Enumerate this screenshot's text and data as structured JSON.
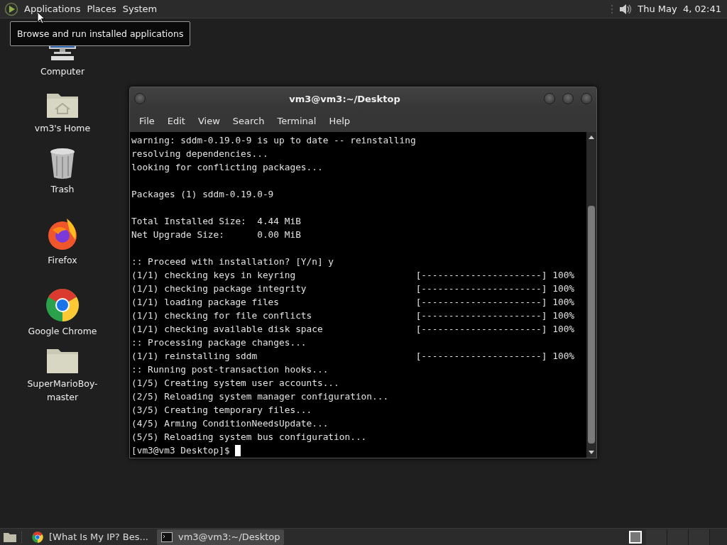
{
  "top_panel": {
    "menus": [
      "Applications",
      "Places",
      "System"
    ],
    "clock": "Thu May  4, 02:41"
  },
  "tooltip": "Browse and run installed applications",
  "desktop_icons": [
    {
      "kind": "computer",
      "label": "Computer"
    },
    {
      "kind": "home",
      "label": "vm3's Home"
    },
    {
      "kind": "trash",
      "label": "Trash"
    },
    {
      "kind": "firefox",
      "label": "Firefox"
    },
    {
      "kind": "chrome",
      "label": "Google Chrome"
    },
    {
      "kind": "folder",
      "label": "SuperMarioBoy-master"
    }
  ],
  "terminal": {
    "title": "vm3@vm3:~/Desktop",
    "menu": [
      "File",
      "Edit",
      "View",
      "Search",
      "Terminal",
      "Help"
    ],
    "blocks": [
      [
        "warning: sddm-0.19.0-9 is up to date -- reinstalling",
        "resolving dependencies...",
        "looking for conflicting packages..."
      ],
      [
        "Packages (1) sddm-0.19.0-9"
      ],
      [
        "Total Installed Size:  4.44 MiB",
        "Net Upgrade Size:      0.00 MiB"
      ],
      [
        ":: Proceed with installation? [Y/n] y",
        "(1/1) checking keys in keyring                      [----------------------] 100%",
        "(1/1) checking package integrity                    [----------------------] 100%",
        "(1/1) loading package files                         [----------------------] 100%",
        "(1/1) checking for file conflicts                   [----------------------] 100%",
        "(1/1) checking available disk space                 [----------------------] 100%",
        ":: Processing package changes...",
        "(1/1) reinstalling sddm                             [----------------------] 100%",
        ":: Running post-transaction hooks...",
        "(1/5) Creating system user accounts...",
        "(2/5) Reloading system manager configuration...",
        "(3/5) Creating temporary files...",
        "(4/5) Arming ConditionNeedsUpdate...",
        "(5/5) Reloading system bus configuration..."
      ]
    ],
    "prompt": "[vm3@vm3 Desktop]$ "
  },
  "taskbar": {
    "tasks": [
      {
        "kind": "browser",
        "label": "[What Is My IP? Bes...",
        "selected": false
      },
      {
        "kind": "terminal",
        "label": "vm3@vm3:~/Desktop",
        "selected": true
      }
    ],
    "workspaces": [
      {
        "selected": true
      },
      {
        "selected": false
      },
      {
        "selected": false
      },
      {
        "selected": false
      }
    ]
  }
}
